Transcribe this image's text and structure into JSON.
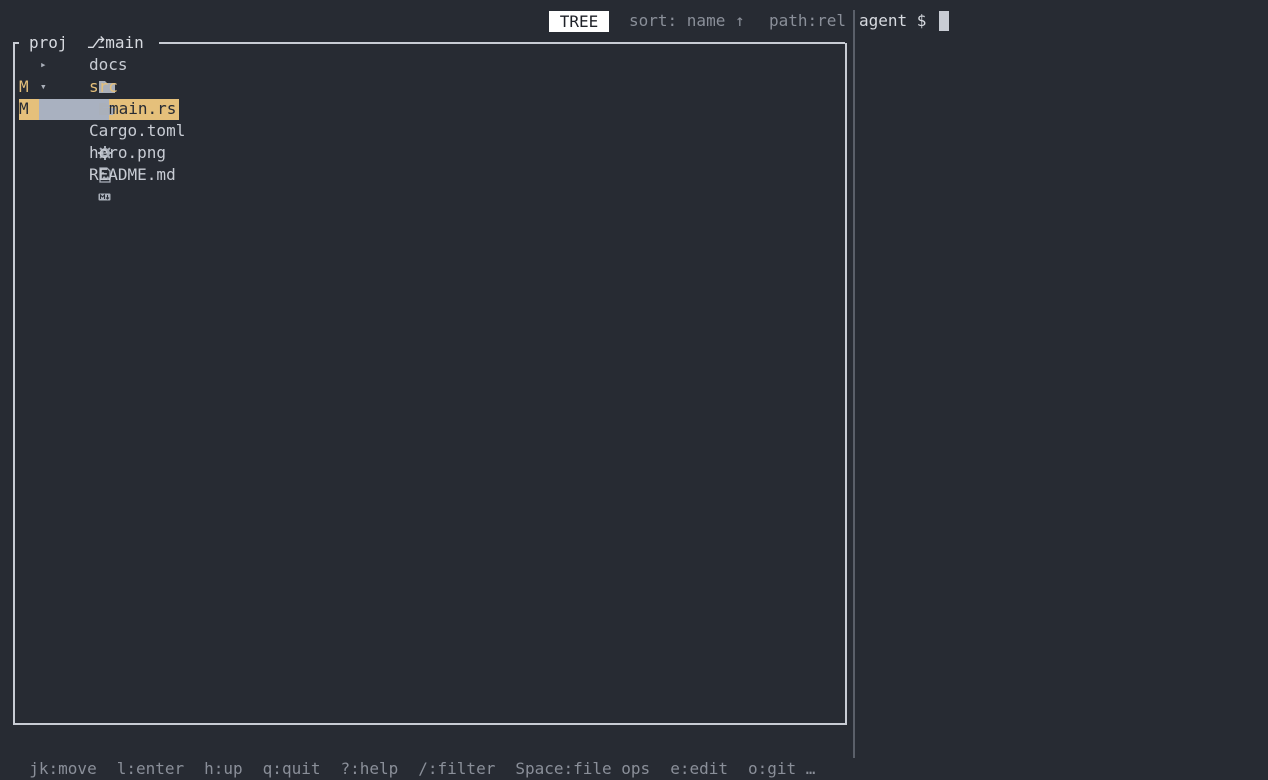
{
  "header": {
    "mode": "TREE",
    "sort": "sort: name ↑",
    "path": "path:rel"
  },
  "terminal": {
    "prompt": "agent $"
  },
  "tree": {
    "title": "proj  ⎇main",
    "items": [
      {
        "git": "",
        "arrow": "▸",
        "icon": "folder-icon",
        "label": "docs"
      },
      {
        "git": "M",
        "arrow": "▾",
        "icon": "folder-open-icon",
        "label": "src"
      },
      {
        "git": "M",
        "arrow": "",
        "icon": "rust-file-icon",
        "label": "main.rs"
      },
      {
        "git": "",
        "arrow": "",
        "icon": "gear-icon",
        "label": "Cargo.toml"
      },
      {
        "git": "",
        "arrow": "",
        "icon": "image-file-icon",
        "label": "hero.png"
      },
      {
        "git": "",
        "arrow": "",
        "icon": "markdown-file-icon",
        "label": "README.md"
      }
    ]
  },
  "help": [
    "jk:move",
    "l:enter",
    "h:up",
    "q:quit",
    "?:help",
    "/:filter",
    "Space:file ops",
    "e:edit",
    "o:git …"
  ],
  "colors": {
    "background": "#272b33",
    "git_modified": "#e5c07b",
    "selection": "#a9b1c0"
  }
}
